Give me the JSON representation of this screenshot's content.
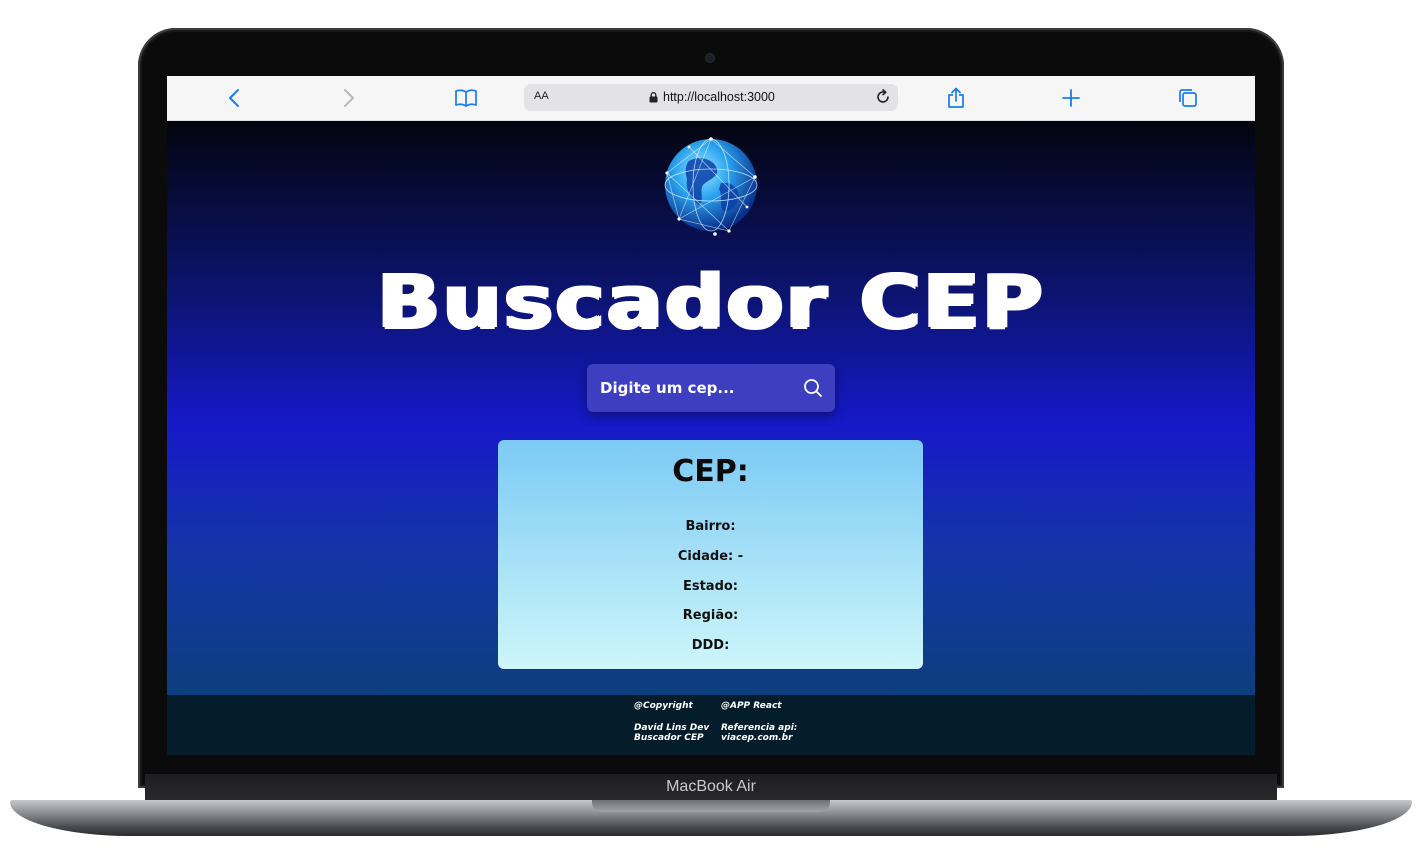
{
  "device": {
    "label": "MacBook Air"
  },
  "browser": {
    "text_size_label": "AA",
    "url": "http://localhost:3000",
    "icons": [
      "back-icon",
      "forward-icon",
      "bookmarks-icon",
      "lock-icon",
      "reload-icon",
      "share-icon",
      "new-tab-icon",
      "tabs-icon"
    ]
  },
  "app": {
    "title": "Buscador CEP",
    "logo_icon": "globe-network-icon",
    "search": {
      "placeholder": "Digite um cep...",
      "value": "",
      "icon": "search-icon"
    },
    "result": {
      "title": "CEP:",
      "fields": [
        {
          "label": "Bairro:"
        },
        {
          "label": "Cidade: -"
        },
        {
          "label": "Estado:"
        },
        {
          "label": "Região:"
        },
        {
          "label": "DDD:"
        }
      ]
    },
    "footer": {
      "col1": {
        "heading": "@Copyright",
        "line1": "David Lins Dev",
        "line2": "Buscador CEP"
      },
      "col2": {
        "heading": "@APP React",
        "line1": "Referencia api:",
        "line2": "viacep.com.br"
      }
    }
  },
  "colors": {
    "page_top": "#03050f",
    "page_mid": "#1619c8",
    "page_bottom": "#0d3f7e",
    "search_bg": "#3d3fc0",
    "card_top": "#7ccaf5",
    "card_bottom": "#cdf6fa",
    "footer_bg": "#051d2a",
    "browser_accent": "#1a7cf0"
  }
}
